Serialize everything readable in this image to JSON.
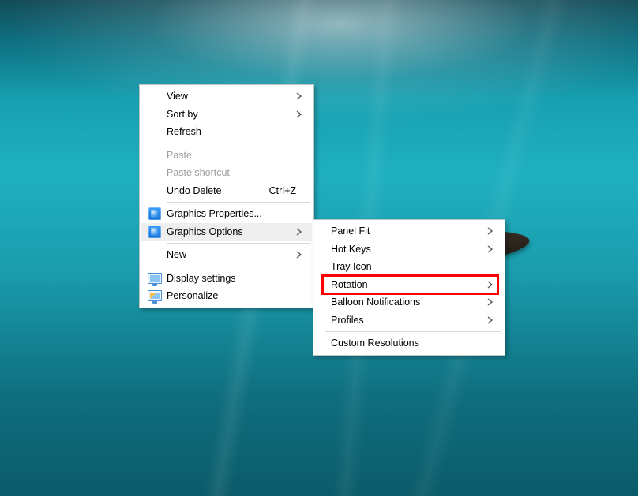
{
  "desktop_menu": {
    "view": {
      "label": "View",
      "submenu": true
    },
    "sort_by": {
      "label": "Sort by",
      "submenu": true
    },
    "refresh": {
      "label": "Refresh"
    },
    "paste": {
      "label": "Paste",
      "disabled": true
    },
    "paste_shortcut": {
      "label": "Paste shortcut",
      "disabled": true
    },
    "undo_delete": {
      "label": "Undo Delete",
      "shortcut": "Ctrl+Z"
    },
    "graphics_props": {
      "label": "Graphics Properties..."
    },
    "graphics_options": {
      "label": "Graphics Options",
      "submenu": true,
      "highlighted": true
    },
    "new": {
      "label": "New",
      "submenu": true
    },
    "display_settings": {
      "label": "Display settings"
    },
    "personalize": {
      "label": "Personalize"
    }
  },
  "graphics_options_submenu": {
    "panel_fit": {
      "label": "Panel Fit",
      "submenu": true
    },
    "hot_keys": {
      "label": "Hot Keys",
      "submenu": true
    },
    "tray_icon": {
      "label": "Tray Icon"
    },
    "rotation": {
      "label": "Rotation",
      "submenu": true,
      "annotated": true
    },
    "balloon_notifications": {
      "label": "Balloon Notifications",
      "submenu": true
    },
    "profiles": {
      "label": "Profiles",
      "submenu": true
    },
    "custom_resolutions": {
      "label": "Custom Resolutions"
    }
  }
}
